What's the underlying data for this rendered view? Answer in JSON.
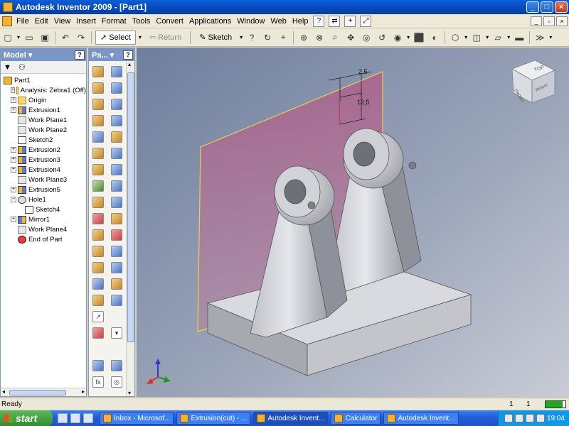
{
  "window": {
    "title": "Autodesk Inventor 2009 - [Part1]",
    "min": "_",
    "max": "□",
    "close": "×",
    "mdi_min": "_",
    "mdi_restore": "▫",
    "mdi_close": "×"
  },
  "menu": {
    "items": [
      "File",
      "Edit",
      "View",
      "Insert",
      "Format",
      "Tools",
      "Convert",
      "Applications",
      "Window",
      "Web",
      "Help"
    ],
    "help_glyph": "?",
    "plus_glyph": "+"
  },
  "toolbar": {
    "select_label": "Select",
    "return_label": "Return",
    "sketch_label": "Sketch"
  },
  "model_panel": {
    "title": "Model",
    "help": "?",
    "tree": [
      {
        "label": "Part1",
        "icon": "part",
        "indent": 0,
        "expander": ""
      },
      {
        "label": "Analysis: Zebra1 (Off)",
        "icon": "folder",
        "indent": 1,
        "expander": "+"
      },
      {
        "label": "Origin",
        "icon": "folder",
        "indent": 1,
        "expander": "+"
      },
      {
        "label": "Extrusion1",
        "icon": "extr",
        "indent": 1,
        "expander": "+"
      },
      {
        "label": "Work Plane1",
        "icon": "wp",
        "indent": 1,
        "expander": ""
      },
      {
        "label": "Work Plane2",
        "icon": "wp",
        "indent": 1,
        "expander": ""
      },
      {
        "label": "Sketch2",
        "icon": "sk",
        "indent": 1,
        "expander": ""
      },
      {
        "label": "Extrusion2",
        "icon": "extr",
        "indent": 1,
        "expander": "+"
      },
      {
        "label": "Extrusion3",
        "icon": "extr",
        "indent": 1,
        "expander": "+"
      },
      {
        "label": "Extrusion4",
        "icon": "extr",
        "indent": 1,
        "expander": "+"
      },
      {
        "label": "Work Plane3",
        "icon": "wp",
        "indent": 1,
        "expander": ""
      },
      {
        "label": "Extrusion5",
        "icon": "extr",
        "indent": 1,
        "expander": "+"
      },
      {
        "label": "Hole1",
        "icon": "hole",
        "indent": 1,
        "expander": "−"
      },
      {
        "label": "Sketch4",
        "icon": "sk",
        "indent": 2,
        "expander": ""
      },
      {
        "label": "Mirror1",
        "icon": "mir",
        "indent": 1,
        "expander": "+"
      },
      {
        "label": "Work Plane4",
        "icon": "wp",
        "indent": 1,
        "expander": ""
      },
      {
        "label": "End of Part",
        "icon": "end",
        "indent": 1,
        "expander": ""
      }
    ]
  },
  "panel_bar": {
    "title": "Pa...",
    "help": "?",
    "fx_label": "fx"
  },
  "viewcube": {
    "top": "TOP",
    "front": "FRONT",
    "right": "RIGHT"
  },
  "sketch_dims": {
    "dim_a": "2,5",
    "dim_b": "12,5"
  },
  "status": {
    "text": "Ready",
    "left_count": "1",
    "right_count": "1",
    "progress": 0.85
  },
  "taskbar": {
    "start": "start",
    "tasks": [
      "Inbox - Microsof...",
      "Extrusion(cut) - ...",
      "Autodesk Invent...",
      "Calculator",
      "Autodesk Invent..."
    ],
    "clock": "19:04"
  },
  "colors": {
    "viewport_bg": "#7b8aa6",
    "title_blue": "#0a5fd8",
    "panel_header": "#7a96c6",
    "plane_tint": "#e070a0"
  }
}
